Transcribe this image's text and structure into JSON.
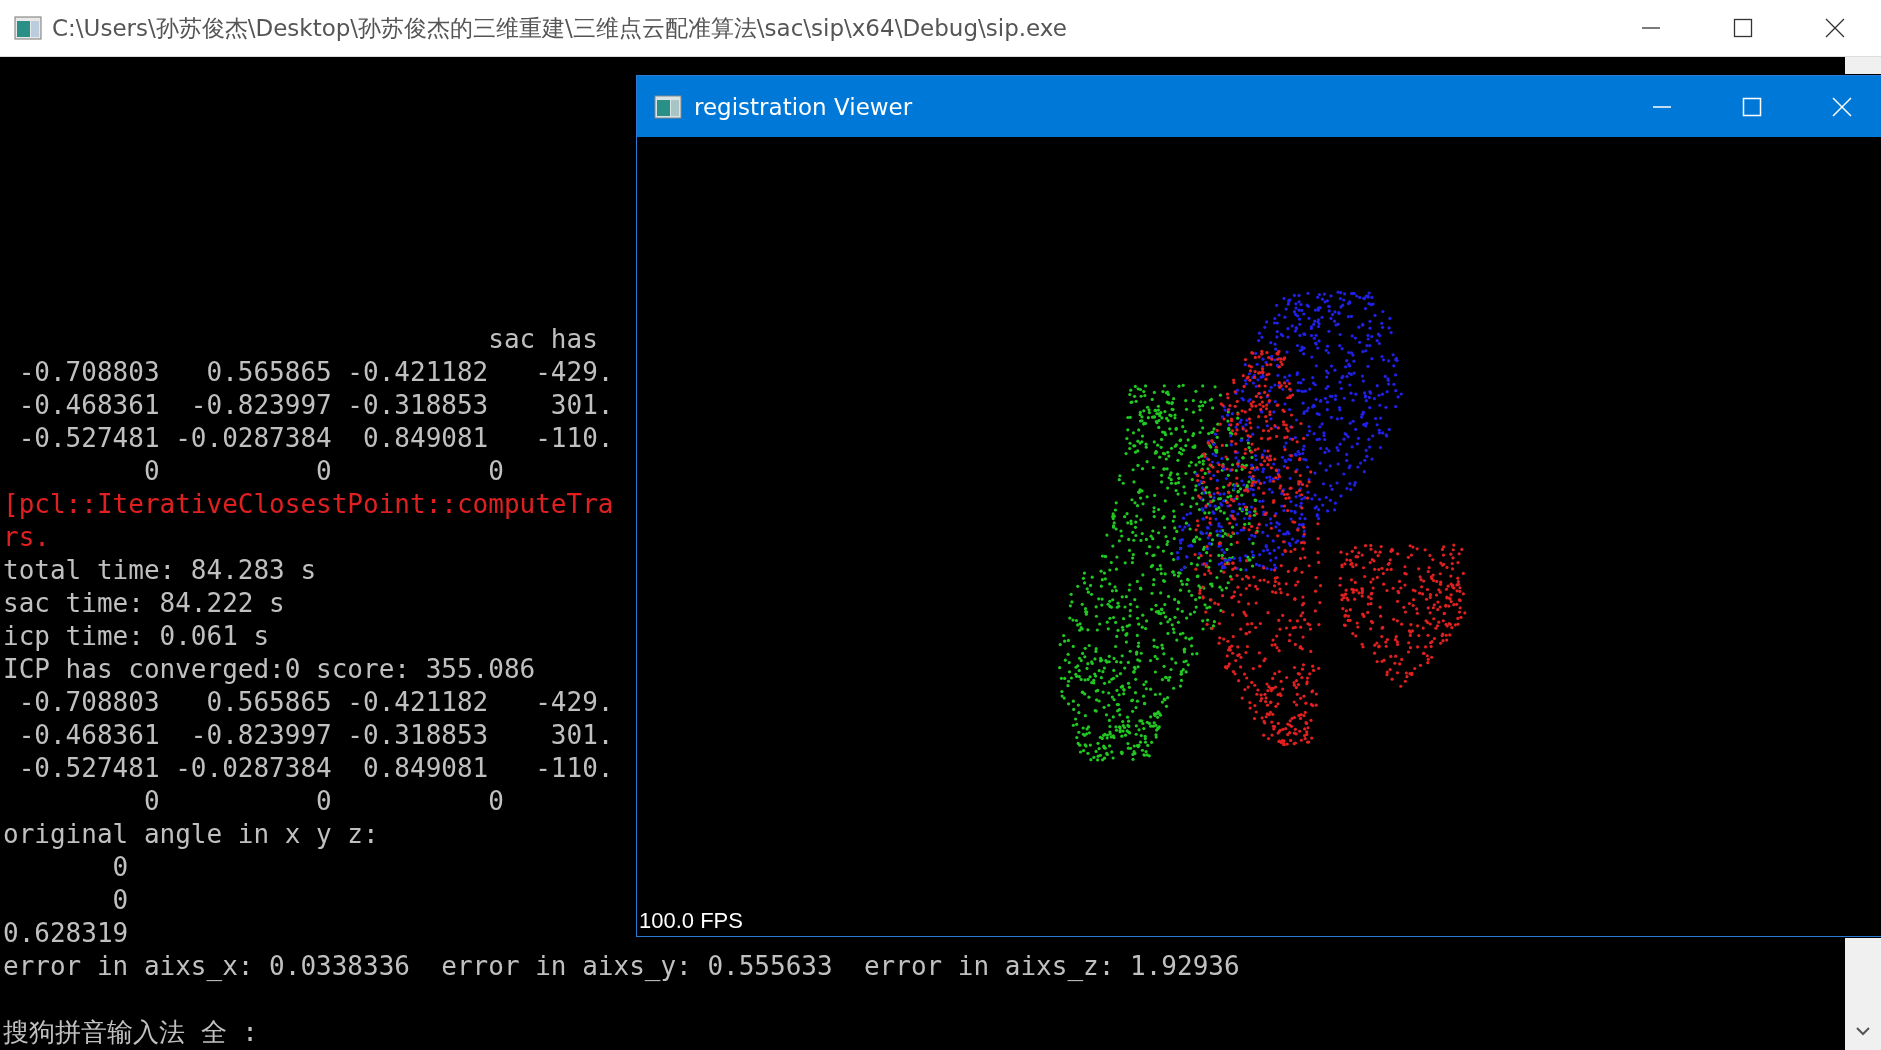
{
  "console_window": {
    "title": "C:\\Users\\孙苏俊杰\\Desktop\\孙苏俊杰的三维重建\\三维点云配准算法\\sac\\sip\\x64\\Debug\\sip.exe"
  },
  "console_lines": [
    {
      "kind": "normal",
      "text": "                               sac has"
    },
    {
      "kind": "normal",
      "text": " -0.708803   0.565865 -0.421182   -429."
    },
    {
      "kind": "normal",
      "text": " -0.468361  -0.823997 -0.318853    301."
    },
    {
      "kind": "normal",
      "text": " -0.527481 -0.0287384  0.849081   -110."
    },
    {
      "kind": "normal",
      "text": "         0          0          0"
    },
    {
      "kind": "error",
      "text": "[pcl::IterativeClosestPoint::computeTra"
    },
    {
      "kind": "error",
      "text": "rs."
    },
    {
      "kind": "normal",
      "text": "total time: 84.283 s"
    },
    {
      "kind": "normal",
      "text": "sac time: 84.222 s"
    },
    {
      "kind": "normal",
      "text": "icp time: 0.061 s"
    },
    {
      "kind": "normal",
      "text": "ICP has converged:0 score: 355.086"
    },
    {
      "kind": "normal",
      "text": " -0.708803   0.565865 -0.421182   -429."
    },
    {
      "kind": "normal",
      "text": " -0.468361  -0.823997 -0.318853    301."
    },
    {
      "kind": "normal",
      "text": " -0.527481 -0.0287384  0.849081   -110."
    },
    {
      "kind": "normal",
      "text": "         0          0          0"
    },
    {
      "kind": "normal",
      "text": "original angle in x y z:"
    },
    {
      "kind": "normal",
      "text": "       0"
    },
    {
      "kind": "normal",
      "text": "       0"
    },
    {
      "kind": "normal",
      "text": "0.628319"
    },
    {
      "kind": "normal",
      "text": "error in aixs_x: 0.0338336  error in aixs_y: 0.555633  error in aixs_z: 1.92936"
    },
    {
      "kind": "blank"
    },
    {
      "kind": "normal",
      "text": "搜狗拼音输入法 全 :"
    }
  ],
  "viewer_window": {
    "title": "registration Viewer",
    "fps": "100.0 FPS"
  }
}
